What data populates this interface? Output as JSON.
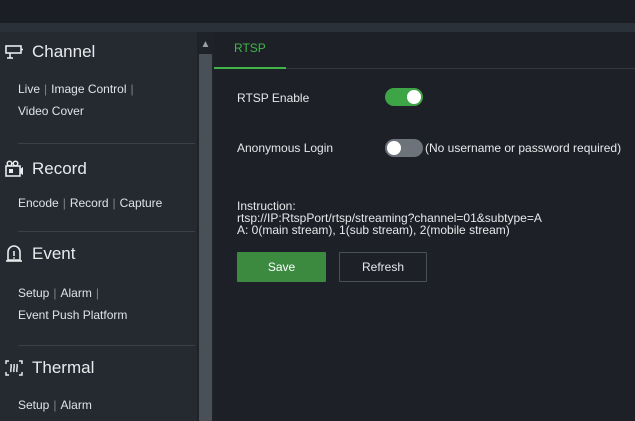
{
  "sidebar": {
    "channel": {
      "title": "Channel",
      "links": [
        "Live",
        "Image Control",
        "Video Cover"
      ]
    },
    "record": {
      "title": "Record",
      "links": [
        "Encode",
        "Record",
        "Capture"
      ]
    },
    "event": {
      "title": "Event",
      "links": [
        "Setup",
        "Alarm",
        "Event Push Platform"
      ]
    },
    "thermal": {
      "title": "Thermal",
      "links": [
        "Setup",
        "Alarm"
      ]
    }
  },
  "main": {
    "tab": "RTSP",
    "rtsp_enable": {
      "label": "RTSP Enable",
      "state": "on"
    },
    "anonymous_login": {
      "label": "Anonymous Login",
      "state": "off",
      "note": "(No username or password required)"
    },
    "instruction": {
      "line1": "Instruction:",
      "line2": "rtsp://IP:RtspPort/rtsp/streaming?channel=01&subtype=A",
      "line3": "A: 0(main stream), 1(sub stream), 2(mobile stream)"
    },
    "buttons": {
      "save": "Save",
      "refresh": "Refresh"
    }
  },
  "colors": {
    "accent": "#42b549",
    "save_button": "#3c8a40",
    "toggle_on": "#3da545",
    "toggle_off": "#6d737a"
  }
}
